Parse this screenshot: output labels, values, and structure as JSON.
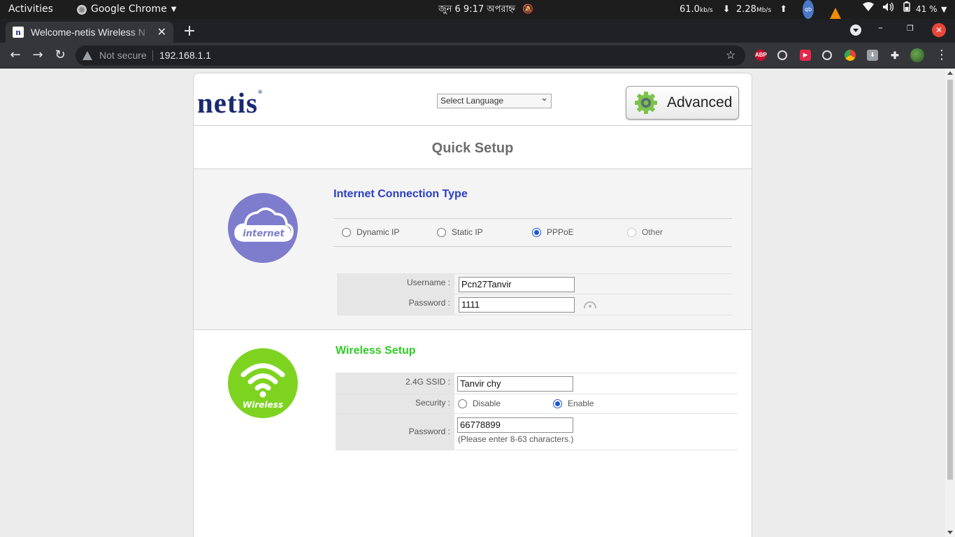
{
  "os_topbar": {
    "activities": "Activities",
    "app_name": "Google Chrome",
    "clock": "জুন 6   9:17 অপরাহ্ন",
    "net_down_value": "61.0",
    "net_down_unit": "kb/s",
    "net_up_value": "2.28",
    "net_up_unit": "Mb/s",
    "battery_pct": "41 %"
  },
  "browser": {
    "tab_title": "Welcome-netis Wireless N",
    "tab_favicon": "n",
    "security_label": "Not secure",
    "url": "192.168.1.1",
    "ext_abp": "ABP"
  },
  "router": {
    "logo": "netis",
    "logo_mark": "®",
    "language_select": "Select Language",
    "advanced_label": "Advanced",
    "page_title": "Quick Setup",
    "internet": {
      "icon_text": "internet",
      "section_title": "Internet Connection Type",
      "connection_types": [
        {
          "label": "Dynamic IP",
          "checked": false,
          "disabled": false
        },
        {
          "label": "Static IP",
          "checked": false,
          "disabled": false
        },
        {
          "label": "PPPoE",
          "checked": true,
          "disabled": false
        },
        {
          "label": "Other",
          "checked": false,
          "disabled": true
        }
      ],
      "username_label": "Username :",
      "username_value": "Pcn27Tanvir",
      "password_label": "Password :",
      "password_value": "1111"
    },
    "wireless": {
      "icon_text": "Wireless",
      "section_title": "Wireless Setup",
      "ssid_label": "2.4G SSID :",
      "ssid_value": "Tanvir chy",
      "security_label": "Security :",
      "security_options": [
        {
          "label": "Disable",
          "checked": false
        },
        {
          "label": "Enable",
          "checked": true
        }
      ],
      "password_label": "Password :",
      "password_value": "66778899",
      "password_hint": "(Please enter 8-63 characters.)"
    }
  }
}
